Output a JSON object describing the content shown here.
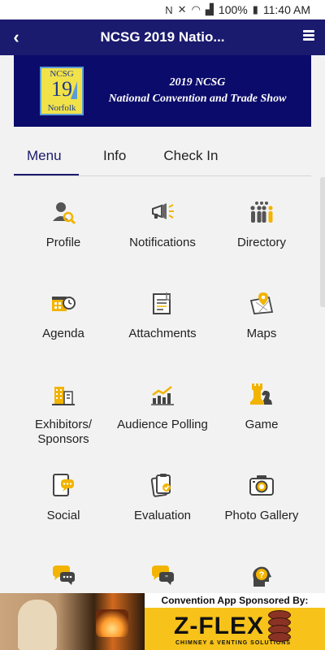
{
  "status_bar": {
    "battery": "100%",
    "time": "11:40 AM"
  },
  "header": {
    "title": "NCSG 2019 Natio...",
    "back_icon": "back-arrow-icon",
    "menu_icon": "hamburger-icon"
  },
  "banner": {
    "logo_top": "NCSG",
    "logo_number": "19",
    "logo_bottom": "Norfolk",
    "line1": "2019 NCSG",
    "line2": "National Convention and Trade Show"
  },
  "tabs": [
    {
      "label": "Menu",
      "active": true
    },
    {
      "label": "Info",
      "active": false
    },
    {
      "label": "Check In",
      "active": false
    }
  ],
  "menu_items": [
    {
      "label": "Profile",
      "icon": "profile-search-icon"
    },
    {
      "label": "Notifications",
      "icon": "megaphone-icon"
    },
    {
      "label": "Directory",
      "icon": "people-group-icon"
    },
    {
      "label": "Agenda",
      "icon": "calendar-clock-icon"
    },
    {
      "label": "Attachments",
      "icon": "document-clip-icon"
    },
    {
      "label": "Maps",
      "icon": "map-pin-icon"
    },
    {
      "label": "Exhibitors/ Sponsors",
      "icon": "buildings-icon"
    },
    {
      "label": "Audience Polling",
      "icon": "bar-chart-icon"
    },
    {
      "label": "Game",
      "icon": "chess-pieces-icon"
    },
    {
      "label": "Social",
      "icon": "chat-tablet-icon"
    },
    {
      "label": "Evaluation",
      "icon": "clipboard-check-icon"
    },
    {
      "label": "Photo Gallery",
      "icon": "camera-icon"
    },
    {
      "label": "",
      "icon": "chat-bubbles-icon"
    },
    {
      "label": "",
      "icon": "quote-bubbles-icon"
    },
    {
      "label": "",
      "icon": "question-head-icon"
    }
  ],
  "sponsor": {
    "headline": "Convention App Sponsored By:",
    "brand": "Z-FLEX",
    "tagline": "CHIMNEY & VENTING SOLUTIONS"
  },
  "colors": {
    "header": "#1a1a6e",
    "accent": "#f2b400",
    "banner": "#0b0b6b"
  }
}
